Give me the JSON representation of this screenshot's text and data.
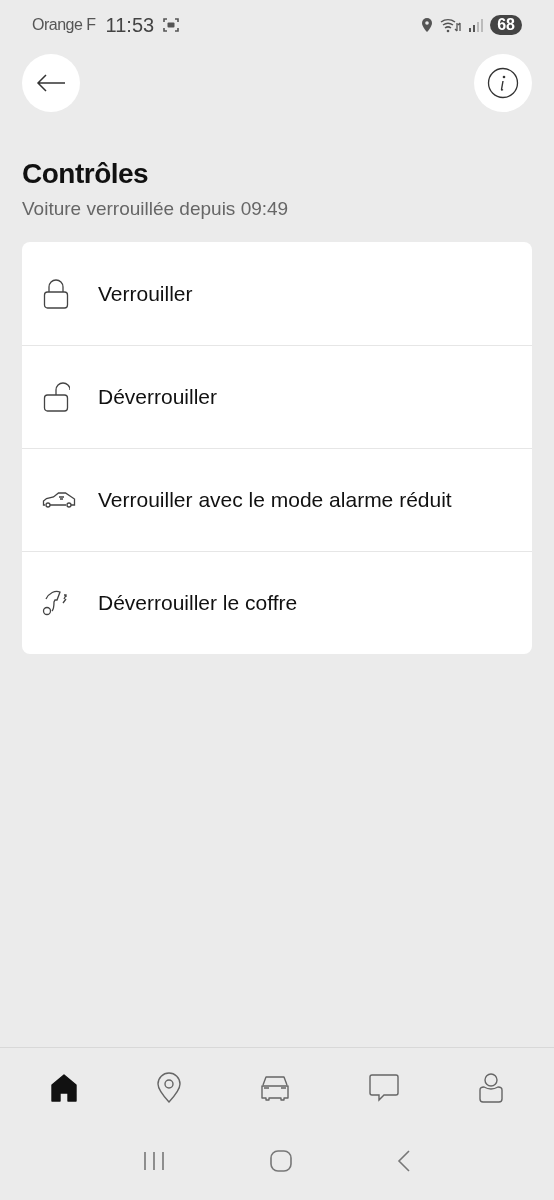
{
  "status_bar": {
    "carrier": "Orange F",
    "time": "11:53",
    "battery": "68"
  },
  "title": "Contrôles",
  "subtitle": "Voiture verrouillée depuis 09:49",
  "controls": [
    {
      "kind": "lock",
      "label": "Verrouiller"
    },
    {
      "kind": "unlock",
      "label": "Déverrouiller"
    },
    {
      "kind": "alarm",
      "label": "Verrouiller avec le mode alarme réduit"
    },
    {
      "kind": "trunk",
      "label": "Déverrouiller le coffre"
    }
  ],
  "bottom_nav": [
    {
      "kind": "home",
      "selected": true
    },
    {
      "kind": "map",
      "selected": false
    },
    {
      "kind": "car",
      "selected": false
    },
    {
      "kind": "chat",
      "selected": false
    },
    {
      "kind": "profile",
      "selected": false
    }
  ]
}
